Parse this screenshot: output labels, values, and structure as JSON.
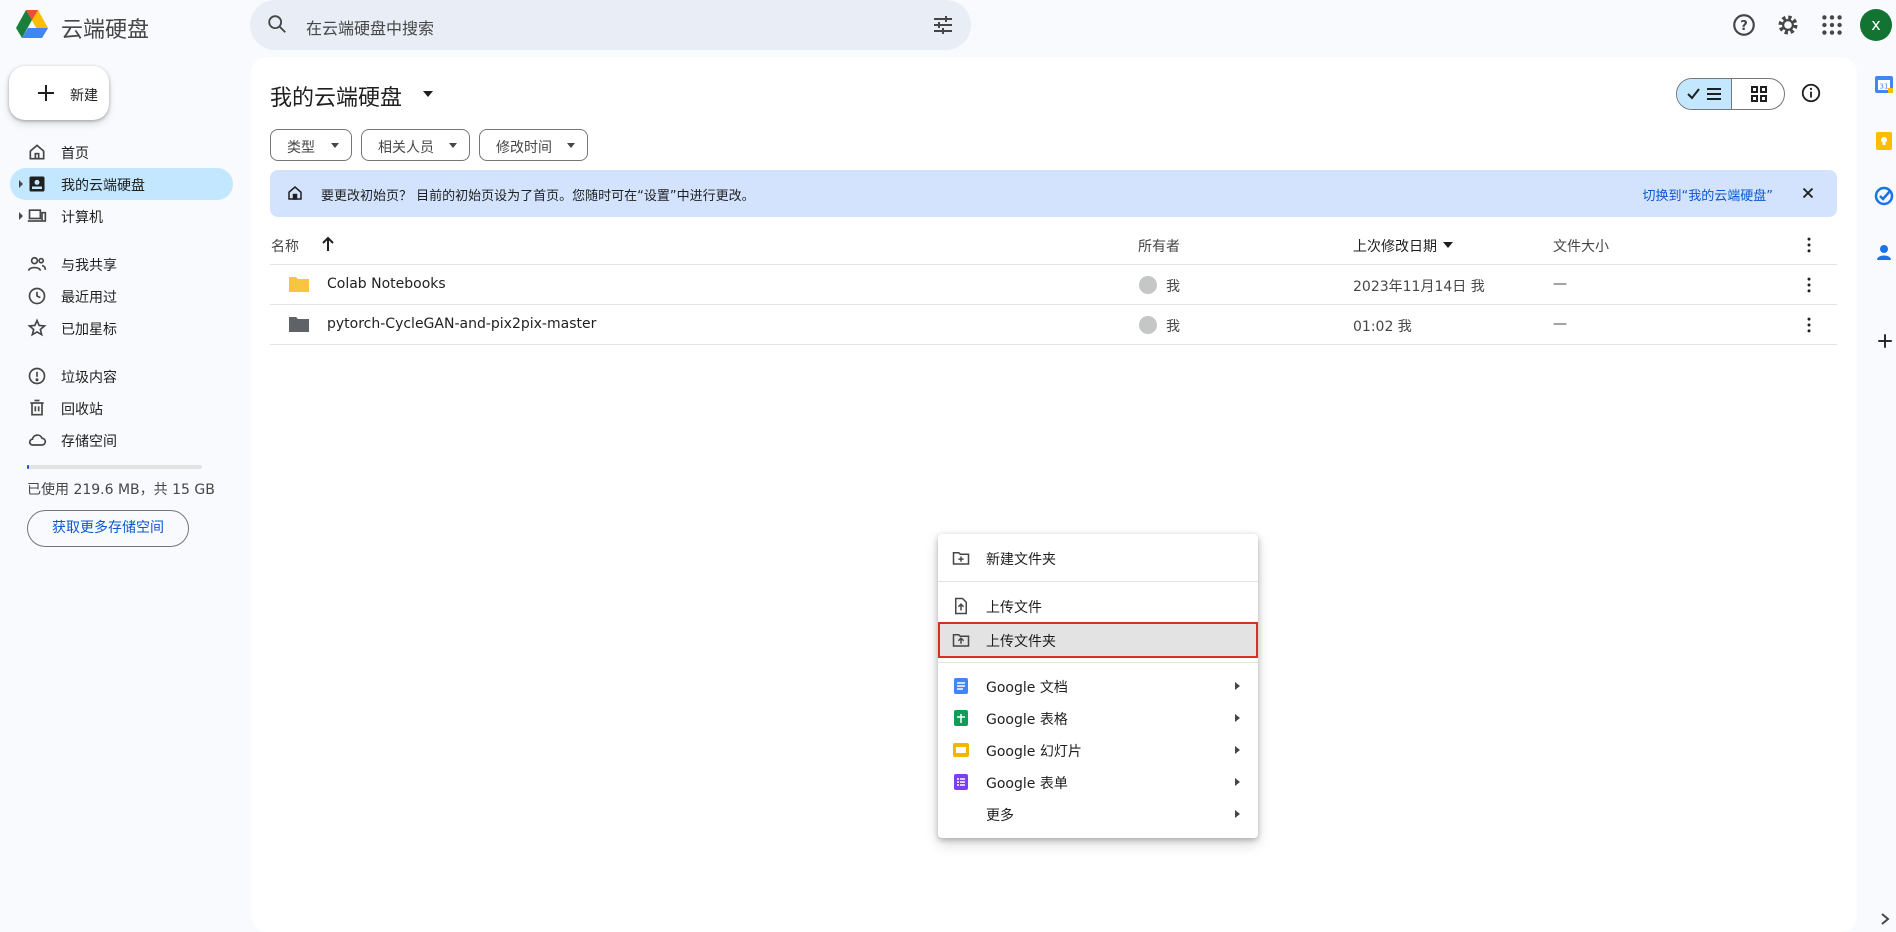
{
  "header": {
    "app_title": "云端硬盘",
    "search_placeholder": "在云端硬盘中搜索",
    "avatar_letter": "x"
  },
  "sidebar": {
    "new_label": "新建",
    "items": [
      {
        "label": "首页",
        "icon": "home-icon"
      },
      {
        "label": "我的云端硬盘",
        "icon": "my-drive-icon",
        "active": true
      },
      {
        "label": "计算机",
        "icon": "computer-icon"
      },
      {
        "label": "与我共享",
        "icon": "shared-icon"
      },
      {
        "label": "最近用过",
        "icon": "clock-icon"
      },
      {
        "label": "已加星标",
        "icon": "star-icon"
      },
      {
        "label": "垃圾内容",
        "icon": "spam-icon"
      },
      {
        "label": "回收站",
        "icon": "trash-icon"
      },
      {
        "label": "存储空间",
        "icon": "cloud-icon"
      }
    ],
    "storage_text": "已使用 219.6 MB，共 15 GB",
    "storage_fraction": 0.014,
    "get_storage": "获取更多存储空间"
  },
  "main": {
    "title": "我的云端硬盘",
    "filters": [
      "类型",
      "相关人员",
      "修改时间"
    ],
    "banner": {
      "text": "要更改初始页？ 目前的初始页设为了首页。您随时可在“设置”中进行更改。",
      "action": "切换到“我的云端硬盘”"
    },
    "columns": {
      "name": "名称",
      "owner": "所有者",
      "modified": "上次修改日期",
      "size": "文件大小"
    },
    "rows": [
      {
        "name": "Colab Notebooks",
        "owner": "我",
        "modified": "2023年11月14日 我",
        "size": "—",
        "folder_color": "#f6c542"
      },
      {
        "name": "pytorch-CycleGAN-and-pix2pix-master",
        "owner": "我",
        "modified": "01:02 我",
        "size": "—",
        "folder_color": "#5f6368"
      }
    ]
  },
  "context_menu": {
    "new_folder": "新建文件夹",
    "upload_file": "上传文件",
    "upload_folder": "上传文件夹",
    "docs": "Google 文档",
    "sheets": "Google 表格",
    "slides": "Google 幻灯片",
    "forms": "Google 表单",
    "more": "更多"
  },
  "colors": {
    "accent": "#0b57d0",
    "active_nav": "#c2e7ff",
    "banner": "#d3e3fd",
    "highlight_outline": "#d93025"
  }
}
